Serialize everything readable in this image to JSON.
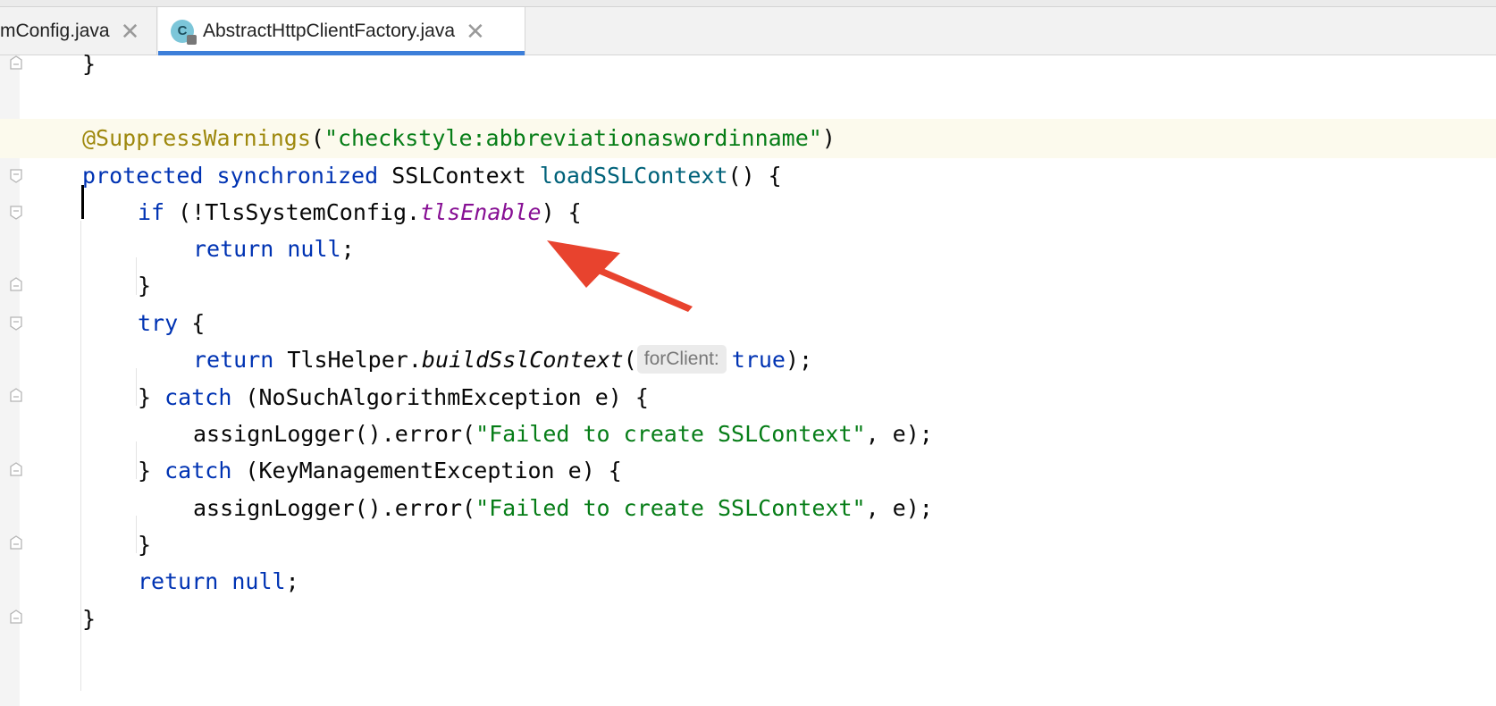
{
  "tabs": [
    {
      "label": "mConfig.java",
      "close": "✕",
      "active": false
    },
    {
      "label": "AbstractHttpClientFactory.java",
      "close": "✕",
      "active": true,
      "icon": "java-class-icon",
      "icon_letter": "C"
    },
    {
      "label_note": ""
    }
  ],
  "colors": {
    "accent": "#3d7fd9",
    "keyword": "#0033b3",
    "string": "#067d17",
    "annotation": "#9e880d",
    "method": "#00627a",
    "field": "#871094",
    "arrow": "#e8432e"
  },
  "code": {
    "l1_brace": "}",
    "l3_annotation": "@SuppressWarnings",
    "l3_open": "(",
    "l3_string": "\"checkstyle:abbreviationaswordinname\"",
    "l3_close": ")",
    "l4_protected": "protected",
    "l4_synchronized": "synchronized",
    "l4_type": "SSLContext",
    "l4_method": "loadSSLContext",
    "l4_rest": "() {",
    "l5_if": "if",
    "l5_open": " (!TlsSystemConfig.",
    "l5_field": "tlsEnable",
    "l5_close": ") {",
    "l6_return": "return",
    "l6_null": "null",
    "l6_semi": ";",
    "l7_brace": "}",
    "l8_try": "try",
    "l8_brace": " {",
    "l9_return": "return",
    "l9_helper": " TlsHelper.",
    "l9_method": "buildSslContext",
    "l9_paren": "(",
    "l9_hint": "forClient:",
    "l9_true": "true",
    "l9_end": ");",
    "l10_brace": "} ",
    "l10_catch": "catch",
    "l10_rest": " (NoSuchAlgorithmException e) {",
    "l11_call": "assignLogger().error(",
    "l11_string": "\"Failed to create SSLContext\"",
    "l11_end": ", e);",
    "l12_brace": "} ",
    "l12_catch": "catch",
    "l12_rest": " (KeyManagementException e) {",
    "l13_call": "assignLogger().error(",
    "l13_string": "\"Failed to create SSLContext\"",
    "l13_end": ", e);",
    "l14_brace": "}",
    "l15_return": "return",
    "l15_null": "null",
    "l15_semi": ";",
    "l16_brace": "}"
  }
}
